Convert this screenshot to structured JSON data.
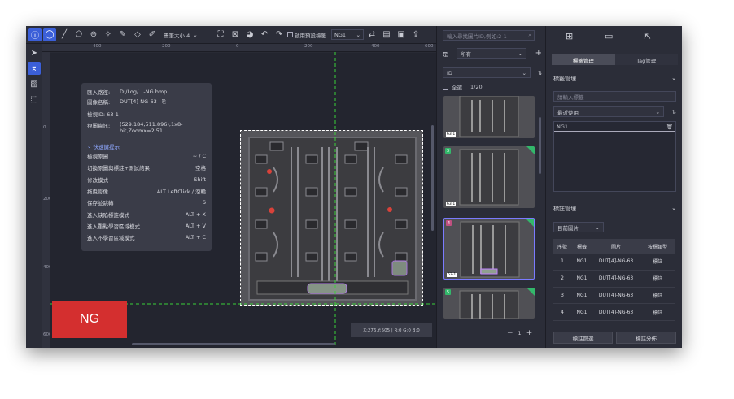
{
  "toolbar": {
    "brush_label": "畫筆大小 4",
    "enable_preset_label": "啟用預設標籤",
    "preset_tag": "NG1"
  },
  "ruler": {
    "h_ticks": [
      "-400",
      "-200",
      "0",
      "200",
      "400",
      "600"
    ],
    "v_ticks": [
      "0",
      "200",
      "400",
      "600"
    ]
  },
  "info": {
    "import_path_label": "匯入路徑:",
    "import_path": "D:/Log/...-NG.bmp",
    "image_name_label": "圖像名稱:",
    "image_name": "DUT[4]-NG-63",
    "view_id": "檢視ID: 63-1",
    "viewport_label": "視圖資訊:",
    "viewport": "(529.184,511.896),1x8-bit,Zoomx=2.51",
    "hint_header": "快速鍵提示",
    "hints": [
      {
        "action": "檢視原圖",
        "key": "~ / C"
      },
      {
        "action": "切換原圖與標註+測試結果",
        "key": "空格"
      },
      {
        "action": "修改模式",
        "key": "Shift"
      },
      {
        "action": "拖曳影像",
        "key": "ALT    LeftClick  /  滾輪"
      },
      {
        "action": "保存並跳轉",
        "key": "S"
      },
      {
        "action": "進入缺陷標註模式",
        "key": "ALT + X"
      },
      {
        "action": "進入重點學習區域模式",
        "key": "ALT + V"
      },
      {
        "action": "進入不學習區域模式",
        "key": "ALT + C"
      }
    ]
  },
  "ng_badge": "NG",
  "coord_readout": "X:276,Y:505  |  R:0 G:0 B:0",
  "thumbs": {
    "search_placeholder": "輸入尋找圖片ID,例如:2-1",
    "filter_label": "是",
    "filter_value": "所有",
    "sort_value": "ID",
    "select_all": "全選",
    "count": "1/20",
    "items": [
      {
        "label": "63-1",
        "num": ""
      },
      {
        "label": "63-1",
        "num": "3"
      },
      {
        "label": "63-1",
        "num": "4"
      },
      {
        "label": "",
        "num": "5"
      }
    ],
    "page": "1"
  },
  "right": {
    "tab_label_mgmt": "標籤管理",
    "tab_tag_mgmt": "Tag管理",
    "label_section": "標籤管理",
    "label_input_placeholder": "請輸入標籤",
    "recent_used": "最近使用",
    "labels": [
      "NG1"
    ],
    "annotation_section": "標註管理",
    "scope": "目前圖片",
    "table_headers": [
      "序號",
      "標籤",
      "圖片",
      "按標類型"
    ],
    "rows": [
      [
        "1",
        "NG1",
        "DUT[4]-NG-63",
        "標註"
      ],
      [
        "2",
        "NG1",
        "DUT[4]-NG-63",
        "標註"
      ],
      [
        "3",
        "NG1",
        "DUT[4]-NG-63",
        "標註"
      ],
      [
        "4",
        "NG1",
        "DUT[4]-NG-63",
        "標註"
      ]
    ],
    "filter_btn": "標註篩選",
    "dist_btn": "標註分佈"
  }
}
